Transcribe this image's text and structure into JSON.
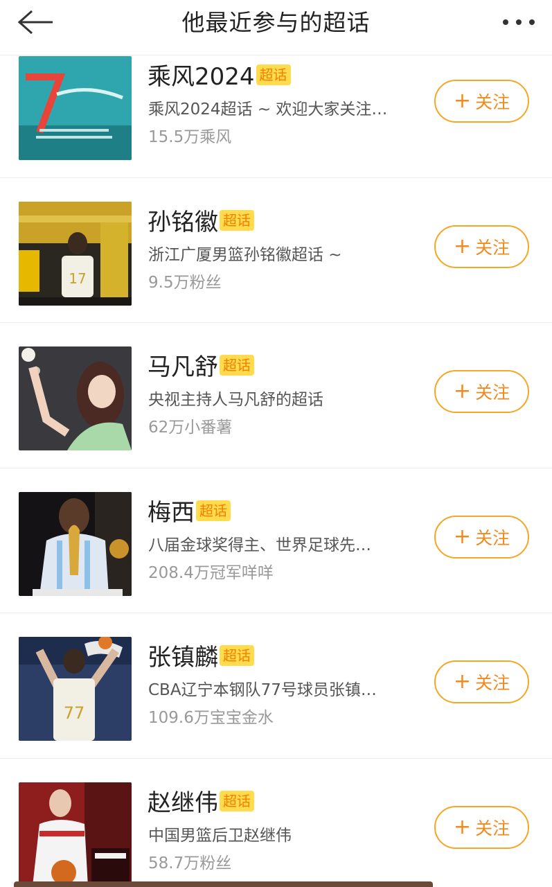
{
  "header": {
    "title": "他最近参与的超话",
    "back_icon": "back-arrow-icon",
    "more_icon": "more-dots-icon"
  },
  "colors": {
    "badge_bg": "#ffdb4d",
    "badge_text": "#f57f00",
    "follow_border": "#f5a623",
    "follow_text": "#f18a1d"
  },
  "follow_label": "关注",
  "topics": [
    {
      "name": "乘风2024",
      "badge": "超话",
      "desc": "乘风2024超话 ~ 欢迎大家关注…",
      "fans": "15.5万乘风",
      "follow": "关注"
    },
    {
      "name": "孙铭徽",
      "badge": "超话",
      "desc": "浙江广厦男篮孙铭徽超话 ~",
      "fans": "9.5万粉丝",
      "follow": "关注"
    },
    {
      "name": "马凡舒",
      "badge": "超话",
      "desc": "央视主持人马凡舒的超话",
      "fans": "62万小番薯",
      "follow": "关注"
    },
    {
      "name": "梅西",
      "badge": "超话",
      "desc": "八届金球奖得主、世界足球先…",
      "fans": "208.4万冠军咩咩",
      "follow": "关注"
    },
    {
      "name": "张镇麟",
      "badge": "超话",
      "desc": "CBA辽宁本钢队77号球员张镇…",
      "fans": "109.6万宝宝金水",
      "follow": "关注"
    },
    {
      "name": "赵继伟",
      "badge": "超话",
      "desc": "中国男篮后卫赵继伟",
      "fans": "58.7万粉丝",
      "follow": "关注"
    }
  ]
}
